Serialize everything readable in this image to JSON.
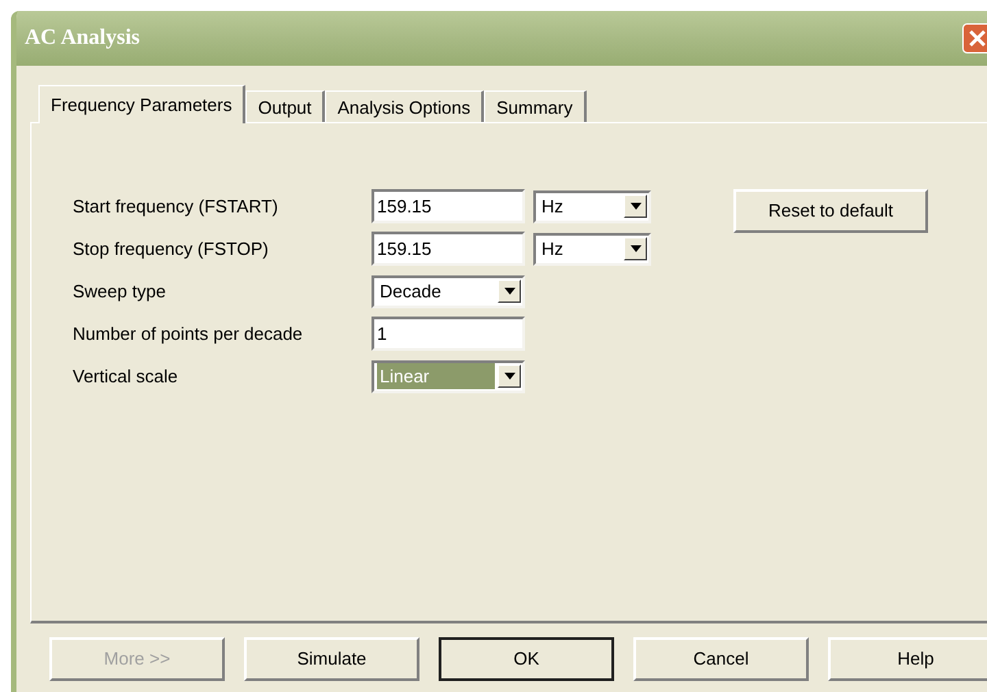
{
  "window": {
    "title": "AC Analysis"
  },
  "tabs": [
    {
      "label": "Frequency Parameters",
      "selected": true
    },
    {
      "label": "Output",
      "selected": false
    },
    {
      "label": "Analysis Options",
      "selected": false
    },
    {
      "label": "Summary",
      "selected": false
    }
  ],
  "fields": [
    {
      "label": "Start frequency (FSTART)",
      "kind": "text",
      "value": "159.15",
      "unit": "Hz"
    },
    {
      "label": "Stop frequency (FSTOP)",
      "kind": "text",
      "value": "159.15",
      "unit": "Hz"
    },
    {
      "label": "Sweep type",
      "kind": "select",
      "value": "Decade",
      "highlighted": false
    },
    {
      "label": "Number of points per decade",
      "kind": "text",
      "value": "1"
    },
    {
      "label": "Vertical scale",
      "kind": "select",
      "value": "Linear",
      "highlighted": true
    }
  ],
  "reset_button": "Reset to default",
  "buttons": [
    {
      "label": "More >>",
      "disabled": true,
      "default": false
    },
    {
      "label": "Simulate",
      "disabled": false,
      "default": false
    },
    {
      "label": "OK",
      "disabled": false,
      "default": true
    },
    {
      "label": "Cancel",
      "disabled": false,
      "default": false
    },
    {
      "label": "Help",
      "disabled": false,
      "default": false
    }
  ]
}
